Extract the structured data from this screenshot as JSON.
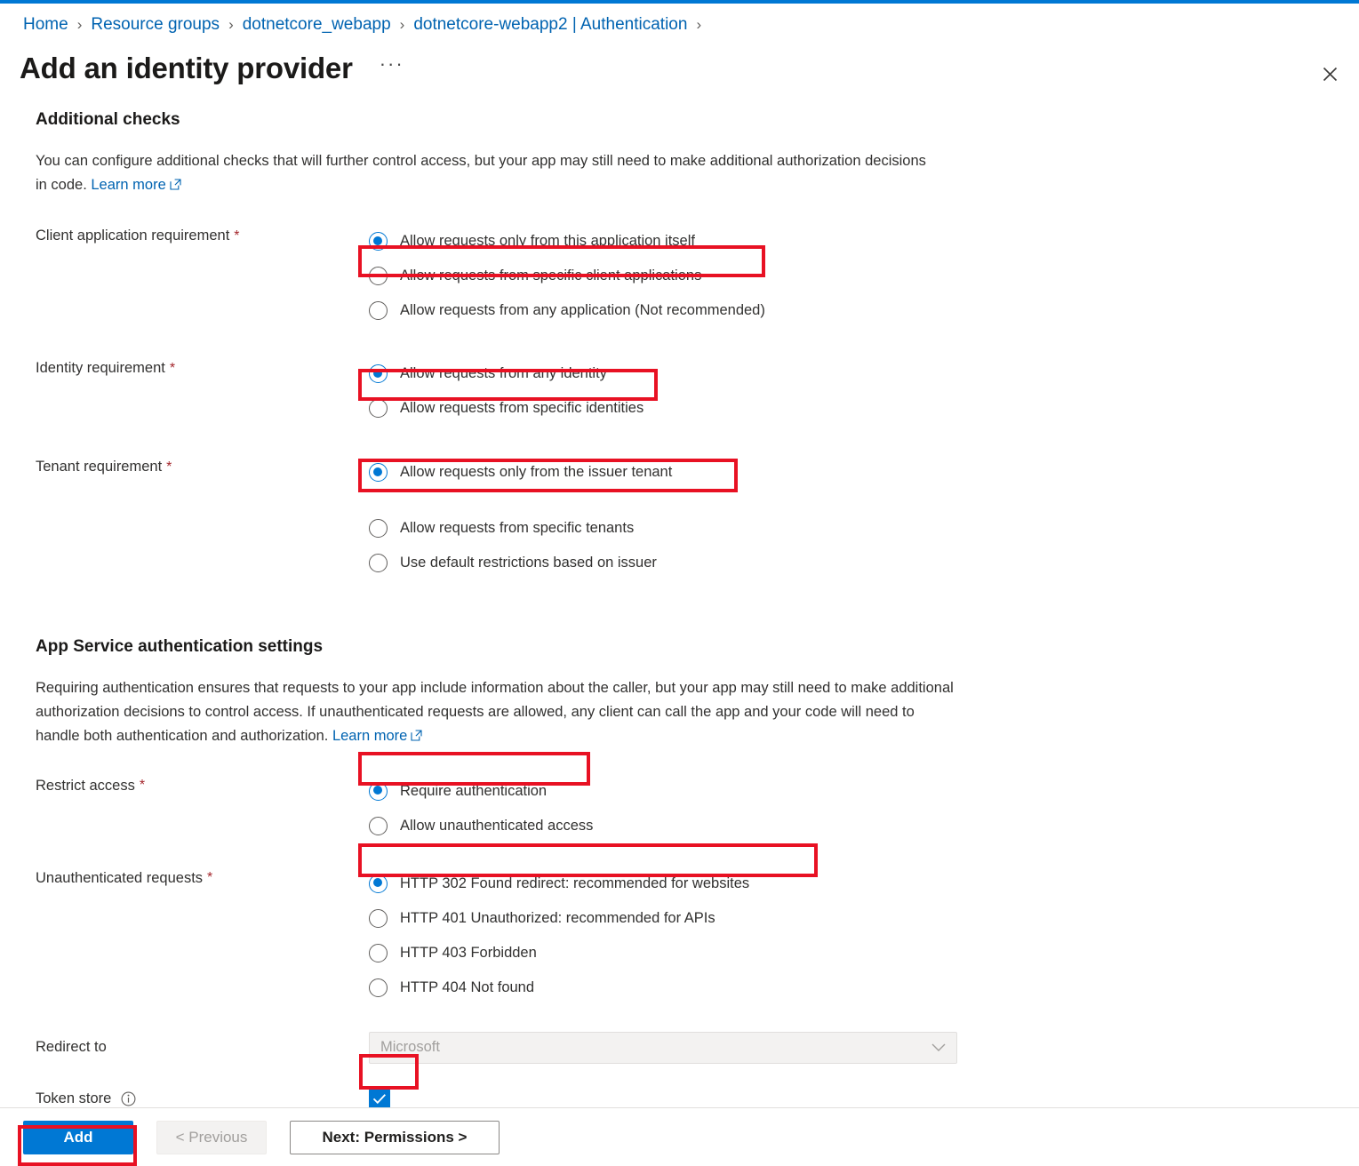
{
  "breadcrumb": {
    "separator": "›",
    "items": [
      {
        "label": "Home"
      },
      {
        "label": "Resource groups"
      },
      {
        "label": "dotnetcore_webapp"
      },
      {
        "label": "dotnetcore-webapp2 | Authentication"
      }
    ]
  },
  "header": {
    "title": "Add an identity provider",
    "more_label": "···",
    "close_icon": "close-icon"
  },
  "colors": {
    "accent": "#0078d4",
    "link": "#0063b1",
    "highlight": "#e81123",
    "required_star": "#a4262c"
  },
  "additional_checks": {
    "heading": "Additional checks",
    "description_part1": "You can configure additional checks that will further control access, but your app may still need to make additional authorization decisions in code. ",
    "learn_more": "Learn more",
    "fields": [
      {
        "label": "Client application requirement",
        "required_mark": "*",
        "options": [
          {
            "label": "Allow requests only from this application itself",
            "checked": true,
            "highlighted": true
          },
          {
            "label": "Allow requests from specific client applications",
            "checked": false,
            "highlighted": false
          },
          {
            "label": "Allow requests from any application (Not recommended)",
            "checked": false,
            "highlighted": false
          }
        ]
      },
      {
        "label": "Identity requirement",
        "required_mark": "*",
        "options": [
          {
            "label": "Allow requests from any identity",
            "checked": true,
            "highlighted": true
          },
          {
            "label": "Allow requests from specific identities",
            "checked": false,
            "highlighted": false
          }
        ]
      },
      {
        "label": "Tenant requirement",
        "required_mark": "*",
        "options": [
          {
            "label": "Allow requests only from the issuer tenant",
            "checked": true,
            "highlighted": true
          },
          {
            "label": "Allow requests from specific tenants",
            "checked": false,
            "highlighted": false,
            "spacer_before": true
          },
          {
            "label": "Use default restrictions based on issuer",
            "checked": false,
            "highlighted": false
          }
        ]
      }
    ]
  },
  "app_service_auth": {
    "heading": "App Service authentication settings",
    "description_part1": "Requiring authentication ensures that requests to your app include information about the caller, but your app may still need to make additional authorization decisions to control access. If unauthenticated requests are allowed, any client can call the app and your code will need to handle both authentication and authorization. ",
    "learn_more": "Learn more",
    "fields": [
      {
        "label": "Restrict access",
        "required_mark": "*",
        "options": [
          {
            "label": "Require authentication",
            "checked": true,
            "highlighted": true
          },
          {
            "label": "Allow unauthenticated access",
            "checked": false,
            "highlighted": false
          }
        ]
      },
      {
        "label": "Unauthenticated requests",
        "required_mark": "*",
        "options": [
          {
            "label": "HTTP 302 Found redirect: recommended for websites",
            "checked": true,
            "highlighted": true
          },
          {
            "label": "HTTP 401 Unauthorized: recommended for APIs",
            "checked": false,
            "highlighted": false
          },
          {
            "label": "HTTP 403 Forbidden",
            "checked": false,
            "highlighted": false
          },
          {
            "label": "HTTP 404 Not found",
            "checked": false,
            "highlighted": false
          }
        ]
      }
    ],
    "redirect_to": {
      "label": "Redirect to",
      "value": "Microsoft",
      "disabled": true,
      "chevron_icon": "chevron-down-icon"
    },
    "token_store": {
      "label": "Token store",
      "info_icon": "info-icon",
      "checked": true,
      "highlighted": true
    }
  },
  "footer": {
    "add_label": "Add",
    "previous_label": "< Previous",
    "next_label": "Next: Permissions >"
  }
}
